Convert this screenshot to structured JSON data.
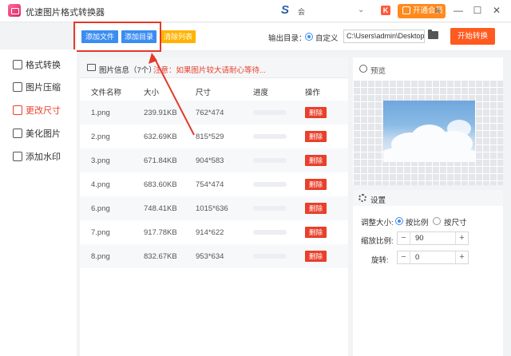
{
  "app": {
    "title": "优速图片格式转换器",
    "vip_label": "开通会员",
    "user_text": "会",
    "window_controls": [
      "≡",
      "—",
      "☐",
      "✕"
    ]
  },
  "toolbar": {
    "add_file": "添加文件",
    "add_dir": "添加目录",
    "clear_list": "清除列表",
    "output_label": "输出目录：",
    "custom_label": "自定义",
    "output_path": "C:\\Users\\admin\\Desktop",
    "start_label": "开始转换"
  },
  "sidebar": {
    "items": [
      {
        "label": "格式转换",
        "icon": "format-convert-icon",
        "active": false
      },
      {
        "label": "图片压缩",
        "icon": "compress-icon",
        "active": false
      },
      {
        "label": "更改尺寸",
        "icon": "resize-icon",
        "active": true
      },
      {
        "label": "美化图片",
        "icon": "beautify-icon",
        "active": false
      },
      {
        "label": "添加水印",
        "icon": "watermark-icon",
        "active": false
      }
    ]
  },
  "list": {
    "info": "图片信息（7个）",
    "warning": "注意：如果图片较大请耐心等待...",
    "columns": [
      "文件名称",
      "大小",
      "尺寸",
      "进度",
      "操作"
    ],
    "delete_label": "删除",
    "rows": [
      {
        "name": "1.png",
        "size": "239.91KB",
        "dims": "762*474"
      },
      {
        "name": "2.png",
        "size": "632.69KB",
        "dims": "815*529"
      },
      {
        "name": "3.png",
        "size": "671.84KB",
        "dims": "904*583"
      },
      {
        "name": "4.png",
        "size": "683.60KB",
        "dims": "754*474"
      },
      {
        "name": "6.png",
        "size": "748.41KB",
        "dims": "1015*636"
      },
      {
        "name": "7.png",
        "size": "917.78KB",
        "dims": "914*622"
      },
      {
        "name": "8.png",
        "size": "832.67KB",
        "dims": "953*634"
      }
    ]
  },
  "preview": {
    "title": "预览"
  },
  "settings": {
    "title": "设置",
    "resize_label": "调整大小:",
    "by_ratio": "按比例",
    "by_size": "按尺寸",
    "scale_label": "缩放比例:",
    "scale_value": "90",
    "rotate_label": "旋转:",
    "rotate_value": "0"
  },
  "colors": {
    "accent_blue": "#3b8df2",
    "accent_red": "#e8402c",
    "accent_orange": "#ff5a1f",
    "clear_yellow": "#ffb300"
  }
}
